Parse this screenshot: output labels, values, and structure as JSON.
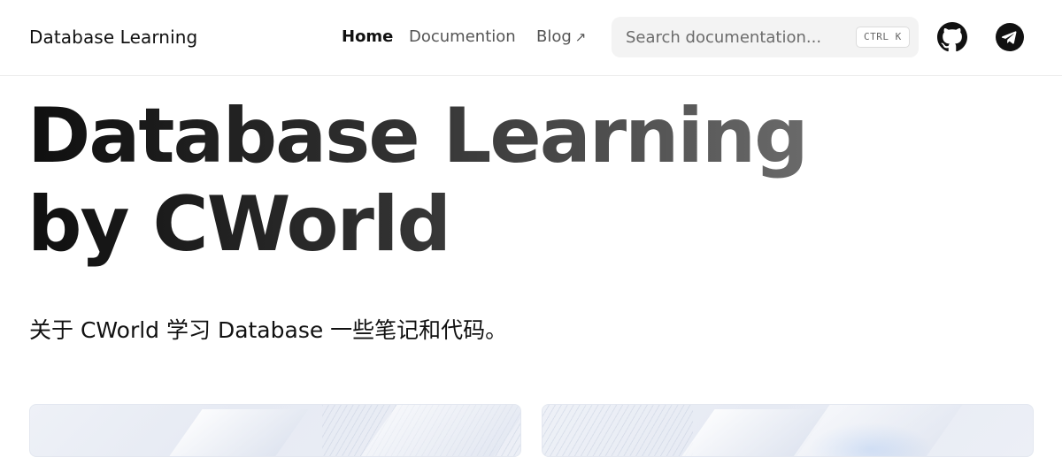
{
  "header": {
    "brand": "Database Learning",
    "nav": [
      {
        "label": "Home",
        "active": true
      },
      {
        "label": "Documention",
        "active": false
      },
      {
        "label": "Blog",
        "external_icon": "↗",
        "active": false
      }
    ],
    "search": {
      "placeholder": "Search documentation...",
      "shortcut": "CTRL K"
    },
    "icons": [
      "github-icon",
      "telegram-icon"
    ]
  },
  "hero": {
    "title_line1": "Database Learning",
    "title_line2": "by CWorld",
    "subtitle": "关于 CWorld 学习 Database 一些笔记和代码。"
  },
  "colors": {
    "title_gradient_start": "#0f0f0f",
    "title_gradient_end": "#6a6a6a",
    "search_bg": "#f3f3f3",
    "nav_inactive": "#555555"
  }
}
